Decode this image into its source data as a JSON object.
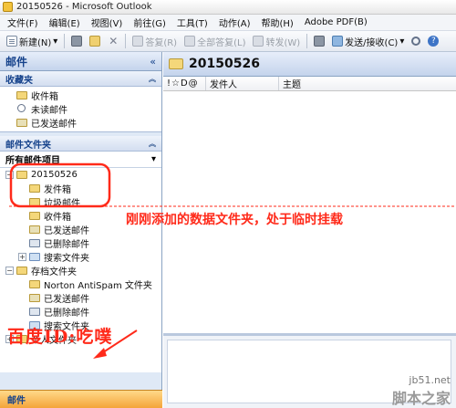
{
  "window": {
    "title": "20150526 - Microsoft Outlook"
  },
  "menu": [
    "文件(F)",
    "编辑(E)",
    "视图(V)",
    "前往(G)",
    "工具(T)",
    "动作(A)",
    "帮助(H)",
    "Adobe PDF(B)"
  ],
  "toolbar": {
    "new_label": "新建(N)",
    "reply_label": "答复(R)",
    "reply_all_label": "全部答复(L)",
    "forward_label": "转发(W)",
    "send_receive_label": "发送/接收(C)"
  },
  "nav": {
    "header_title": "邮件",
    "collapse_glyph": "«",
    "favorites_title": "收藏夹",
    "favorites": [
      {
        "label": "收件箱",
        "icon": "inbox-folder-icon"
      },
      {
        "label": "未读邮件",
        "icon": "search-folder-icon"
      },
      {
        "label": "已发送邮件",
        "icon": "sent-folder-icon"
      }
    ],
    "mail_folders_title": "邮件文件夹",
    "all_items_label": "所有邮件项目",
    "tree": {
      "pst_root": "20150526",
      "pst_children": [
        "发件箱",
        "垃圾邮件",
        "收件箱",
        "已发送邮件",
        "已删除邮件",
        "搜索文件夹"
      ],
      "archive_root": "存档文件夹",
      "archive_children": [
        "Norton AntiSpam 文件夹",
        "已发送邮件",
        "已删除邮件",
        "搜索文件夹"
      ],
      "personal_root": "个人文件夹"
    },
    "bottom_label": "邮件"
  },
  "main": {
    "title": "20150526",
    "col_icons": "!☆D@",
    "col_from": "发件人",
    "col_subject": "主题"
  },
  "annotations": {
    "note": "刚刚添加的数据文件夹，处于临时挂载",
    "baidu_id": "百度ID:吃噗",
    "site_small": "jb51.net",
    "site_big": "脚本之家"
  },
  "colors": {
    "annotation_red": "#ff2a1a",
    "nav_bg": "#dfe9f6",
    "header_blue": "#15428b"
  }
}
